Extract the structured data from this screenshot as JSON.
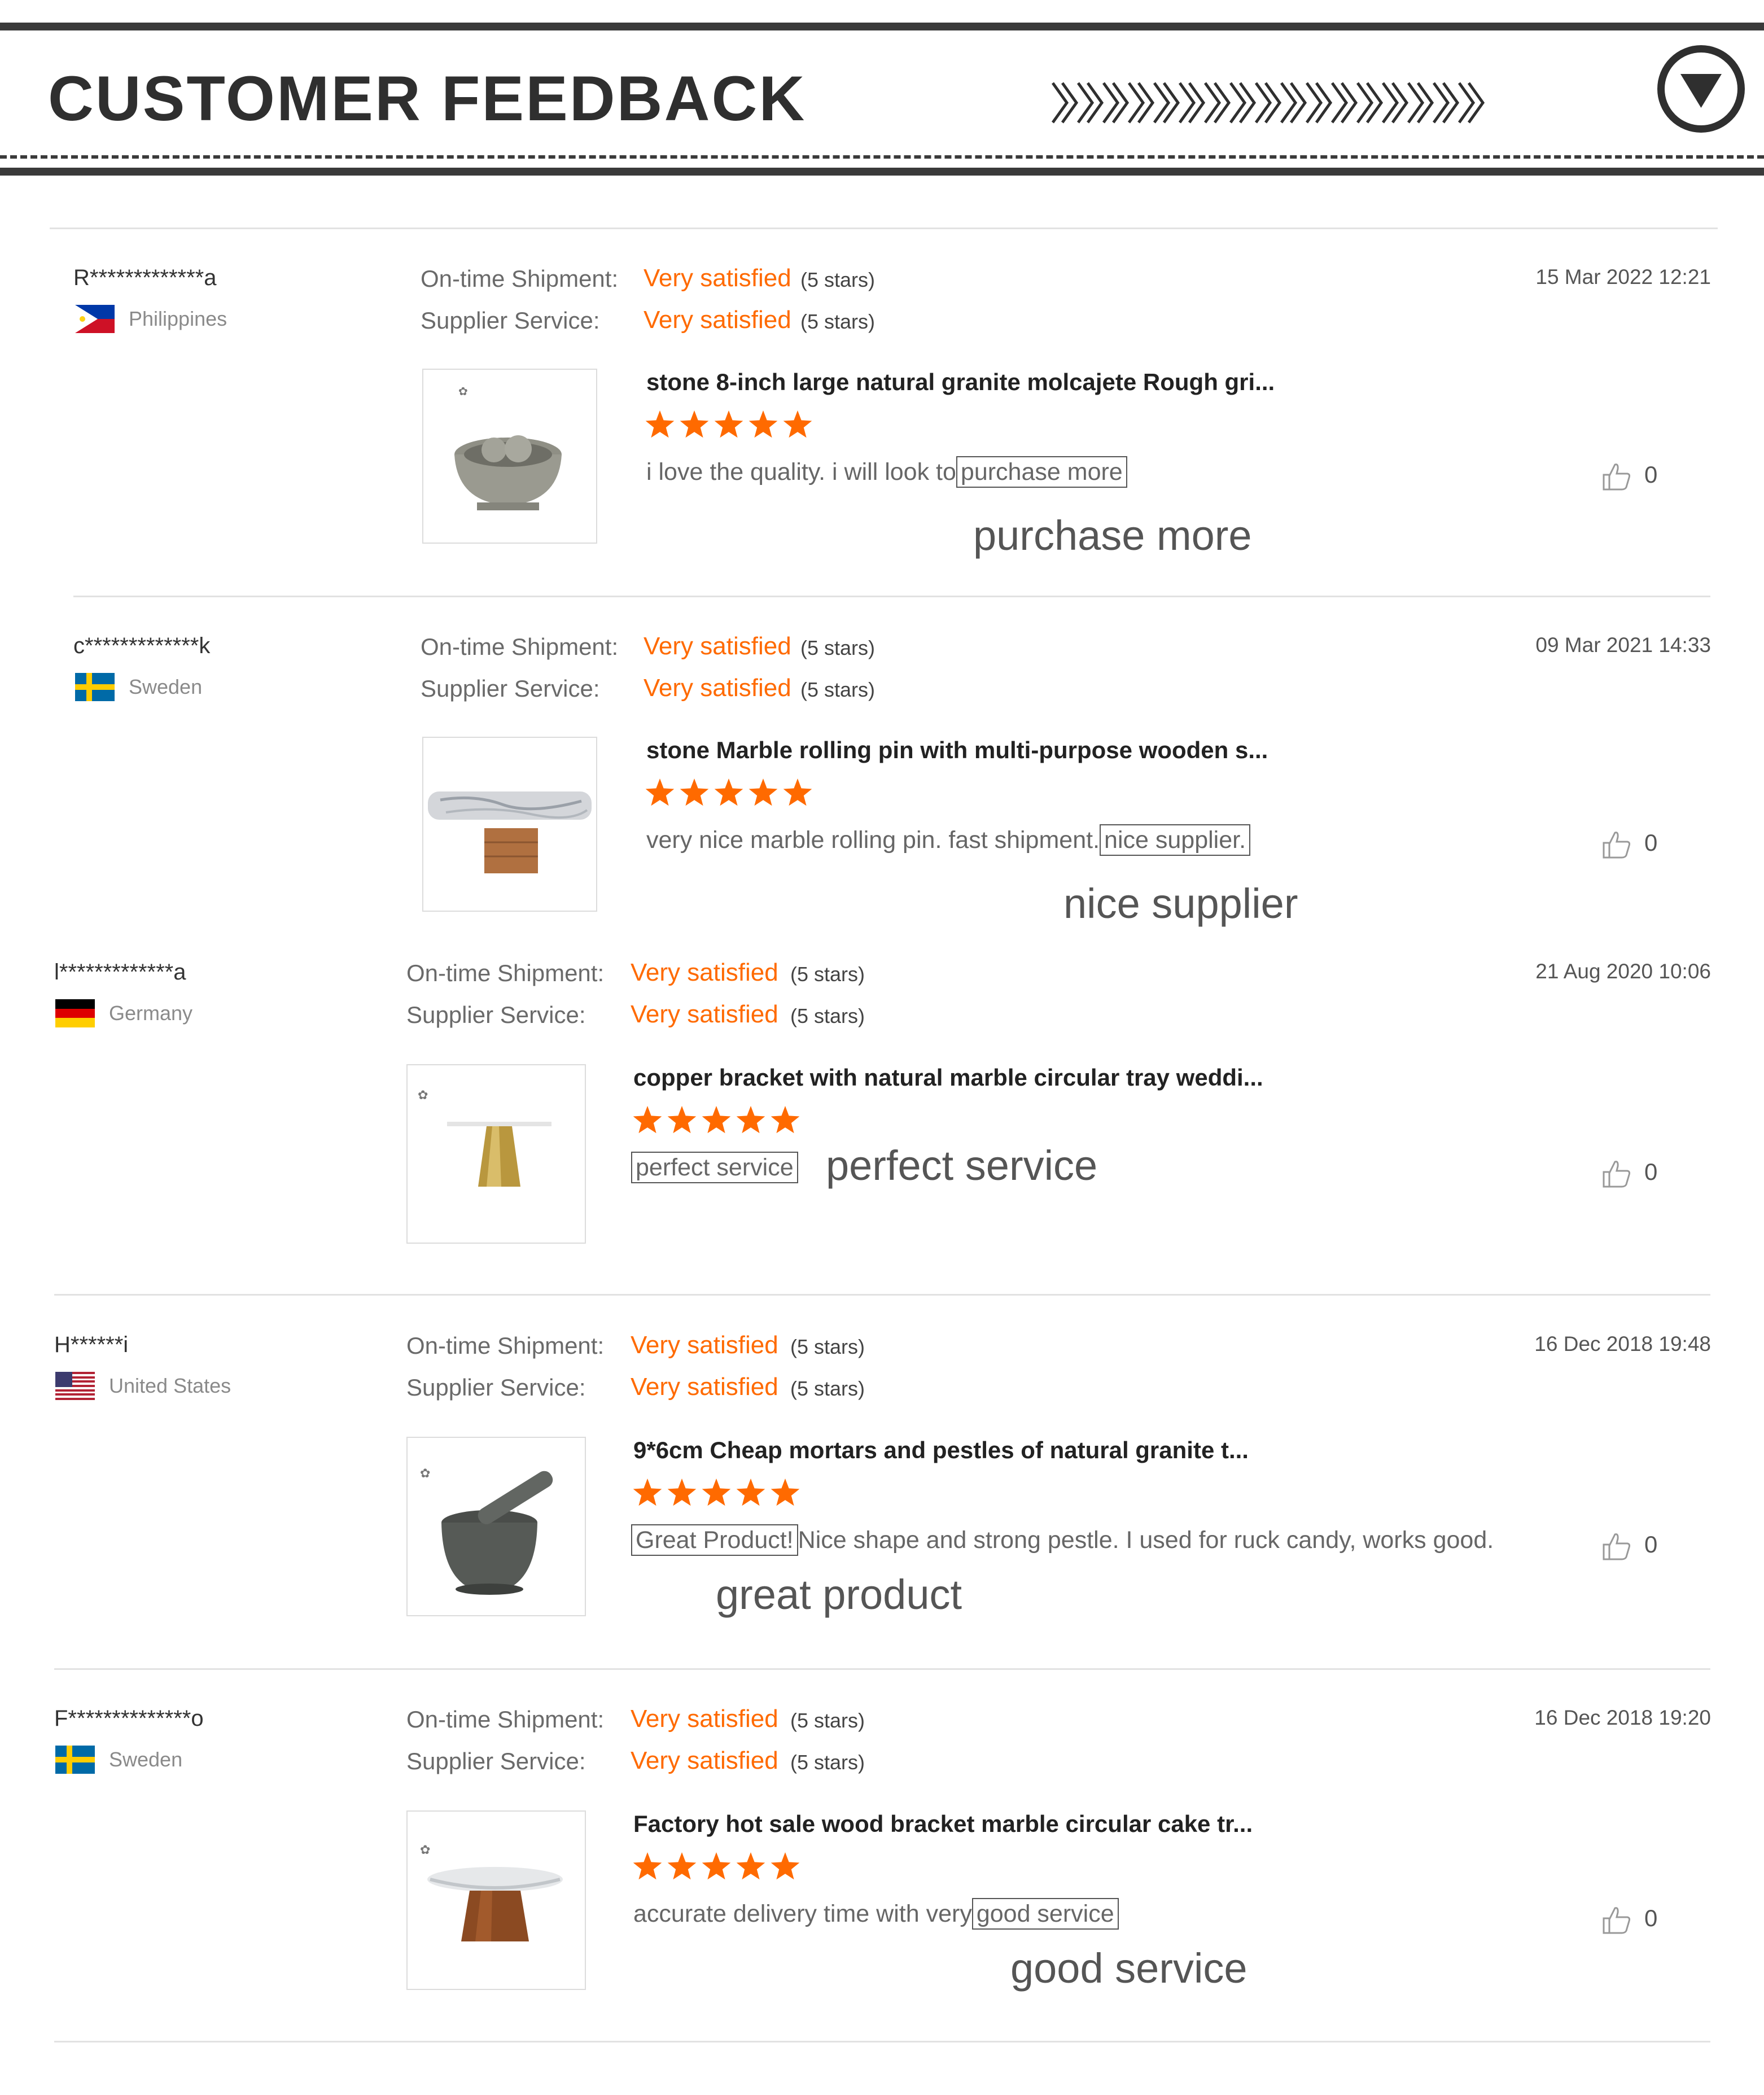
{
  "header": {
    "title": "CUSTOMER FEEDBACK",
    "chevrons": "》》》》》》》》》》》》》》》》》",
    "toggle_icon": "triangle-down-circle-icon"
  },
  "labels": {
    "ontime": "On-time Shipment:",
    "service": "Supplier Service:"
  },
  "colors": {
    "accent": "#ff6a00",
    "dark": "#2f2f2f"
  },
  "reviews": [
    {
      "user": "R*************a",
      "country": "Philippines",
      "flag": "flag-philippines-icon",
      "date": "15 Mar 2022 12:21",
      "ontime_value": "Very satisfied",
      "ontime_stars": "(5 stars)",
      "service_value": "Very satisfied",
      "service_stars": "(5 stars)",
      "product": "stone 8-inch large natural granite molcajete Rough gri...",
      "product_image": "granite-molcajete-bowl",
      "rating": 5,
      "comment_before": "i love the quality. i will look to",
      "comment_highlight": "purchase more",
      "comment_after": "",
      "callout": "purchase more",
      "likes": "0"
    },
    {
      "user": "c*************k",
      "country": "Sweden",
      "flag": "flag-sweden-icon",
      "date": "09 Mar 2021 14:33",
      "ontime_value": "Very satisfied",
      "ontime_stars": "(5 stars)",
      "service_value": "Very satisfied",
      "service_stars": "(5 stars)",
      "product": "stone Marble rolling pin with multi-purpose wooden s...",
      "product_image": "marble-rolling-pin",
      "rating": 5,
      "comment_before": "very nice marble rolling pin. fast shipment.",
      "comment_highlight": "nice supplier.",
      "comment_after": "",
      "callout": "nice supplier",
      "likes": "0"
    },
    {
      "user": "l*************a",
      "country": "Germany",
      "flag": "flag-germany-icon",
      "date": "21 Aug 2020 10:06",
      "ontime_value": "Very satisfied",
      "ontime_stars": "(5 stars)",
      "service_value": "Very satisfied",
      "service_stars": "(5 stars)",
      "product": "copper bracket with natural marble circular tray weddi...",
      "product_image": "marble-cake-stand-copper",
      "rating": 5,
      "comment_before": "",
      "comment_highlight": "perfect service",
      "comment_after": "",
      "callout": "perfect service",
      "likes": "0"
    },
    {
      "user": "H******i",
      "country": "United States",
      "flag": "flag-usa-icon",
      "date": "16 Dec 2018 19:48",
      "ontime_value": "Very satisfied",
      "ontime_stars": "(5 stars)",
      "service_value": "Very satisfied",
      "service_stars": "(5 stars)",
      "product": "9*6cm Cheap mortars and pestles of natural granite t...",
      "product_image": "granite-mortar-pestle",
      "rating": 5,
      "comment_before": "",
      "comment_highlight": "Great Product!",
      "comment_after": "Nice shape and strong pestle. I used for ruck candy, works good.",
      "callout": "great product",
      "likes": "0"
    },
    {
      "user": "F**************o",
      "country": "Sweden",
      "flag": "flag-sweden-icon",
      "date": "16 Dec 2018 19:20",
      "ontime_value": "Very satisfied",
      "ontime_stars": "(5 stars)",
      "service_value": "Very satisfied",
      "service_stars": "(5 stars)",
      "product": "Factory hot sale wood bracket marble circular cake tr...",
      "product_image": "marble-cake-stand-wood",
      "rating": 5,
      "comment_before": "accurate delivery time with very",
      "comment_highlight": "good service",
      "comment_after": "",
      "callout": "good service",
      "likes": "0"
    }
  ]
}
